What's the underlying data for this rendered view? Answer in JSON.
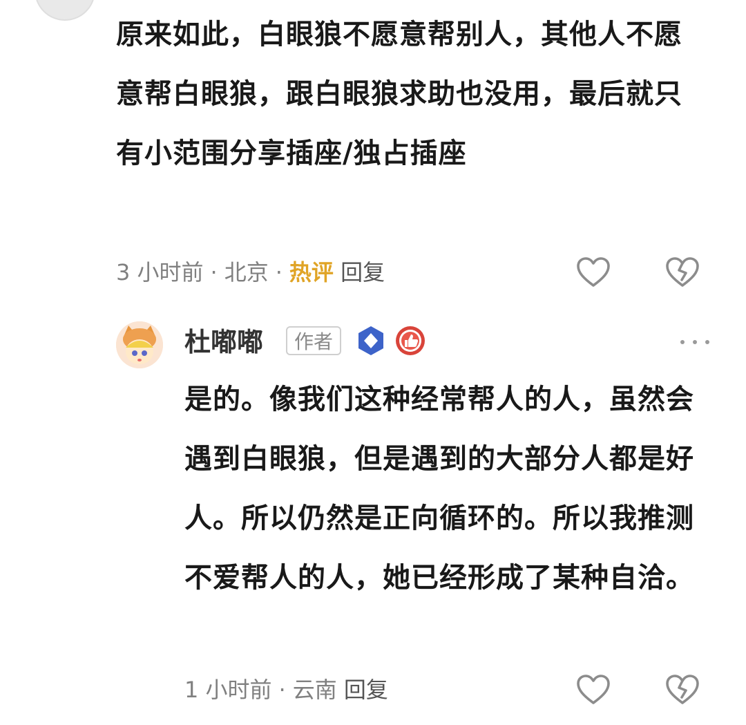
{
  "comments": [
    {
      "text": "原来如此，白眼狼不愿意帮别人，其他人不愿意帮白眼狼，跟白眼狼求助也没用，最后就只有小范围分享插座/独占插座",
      "time": "3 小时前",
      "location": "北京",
      "hot_label": "热评",
      "reply_label": "回复",
      "like_icon": "heart-outline-icon",
      "dislike_icon": "broken-heart-icon"
    },
    {
      "username": "杜嘟嘟",
      "author_tag": "作者",
      "badges": [
        "diamond-badge-icon",
        "thumbs-up-badge-icon"
      ],
      "text": "是的。像我们这种经常帮人的人，虽然会遇到白眼狼，但是遇到的大部分人都是好人。所以仍然是正向循环的。所以我推测不爱帮人的人，她已经形成了某种自洽。",
      "time": "1 小时前",
      "location": "云南",
      "reply_label": "回复",
      "more_icon": "more-dots-icon",
      "like_icon": "heart-outline-icon",
      "dislike_icon": "broken-heart-icon"
    }
  ],
  "colors": {
    "hot_label": "#e0a426",
    "meta_text": "#808080",
    "body_text": "#191919",
    "icon_gray": "#8c8c8c",
    "diamond_badge": "#3d63c9",
    "thumb_badge": "#d9443a"
  }
}
